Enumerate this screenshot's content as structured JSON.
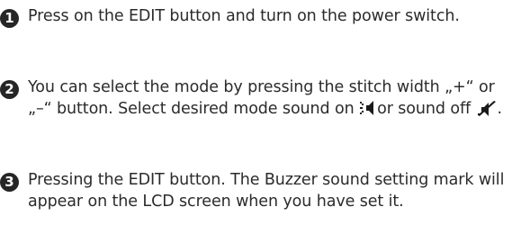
{
  "steps": [
    {
      "number": "1",
      "text": "Press on the EDIT button and turn on the power switch."
    },
    {
      "number": "2",
      "text_before_on_icon": "You can select the mode by pressing the stitch width „+“ or „–“ button. Select desired mode sound on",
      "on_icon": "sound-on-icon",
      "text_between_icons": "or sound off",
      "off_icon": "sound-off-icon",
      "text_after_off_icon": "."
    },
    {
      "number": "3",
      "text": "Pressing the EDIT button. The Buzzer sound setting mark will appear on the LCD screen when you have set it."
    }
  ]
}
